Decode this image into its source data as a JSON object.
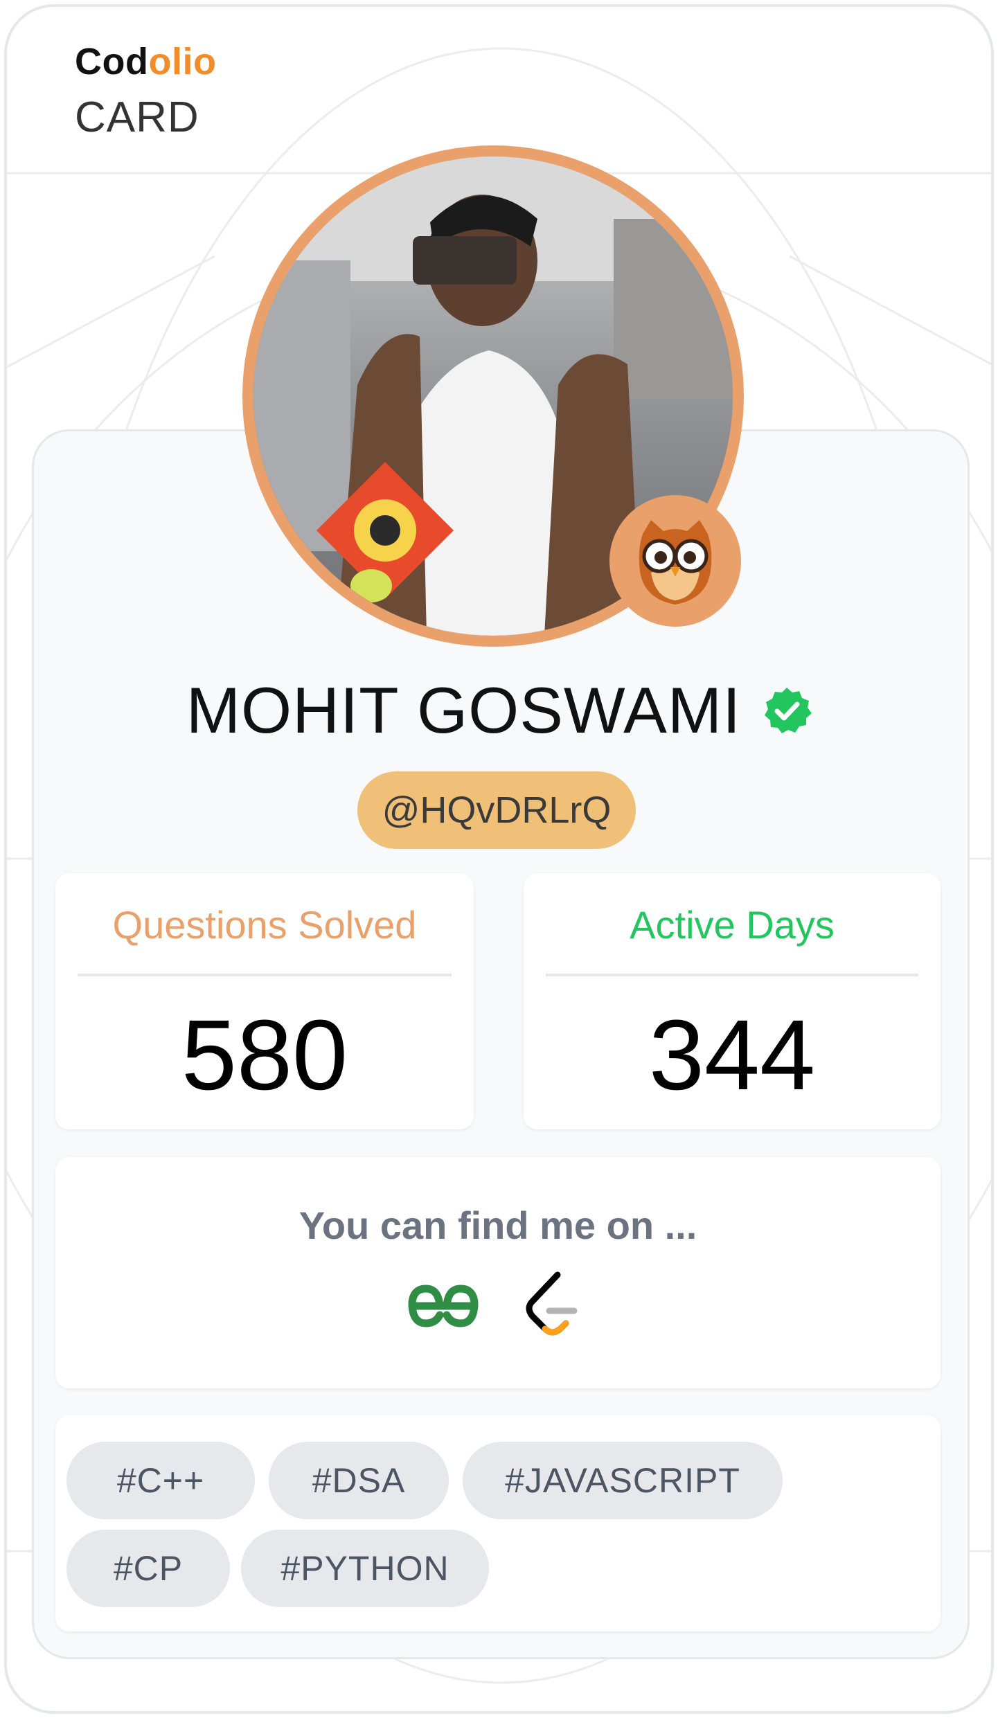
{
  "brand": {
    "name_part1": "Cod",
    "name_part2": "olio",
    "subtitle": "CARD",
    "accent_color": "#f28c28"
  },
  "profile": {
    "avatar_icon": "profile-photo",
    "badge_icon": "owl-icon",
    "name": "MOHIT GOSWAMI",
    "verified_icon": "verified-check-icon",
    "handle": "@HQvDRLrQ"
  },
  "stats": {
    "questions_label": "Questions Solved",
    "questions_value": "580",
    "questions_color": "#e9a06a",
    "active_label": "Active Days",
    "active_value": "344",
    "active_color": "#22c55e"
  },
  "find": {
    "title": "You can find me on ...",
    "platforms": [
      {
        "name": "GeeksforGeeks",
        "icon": "geeksforgeeks-icon"
      },
      {
        "name": "LeetCode",
        "icon": "leetcode-icon"
      }
    ]
  },
  "tags": [
    "#C++",
    "#DSA",
    "#JAVASCRIPT",
    "#CP",
    "#PYTHON"
  ]
}
